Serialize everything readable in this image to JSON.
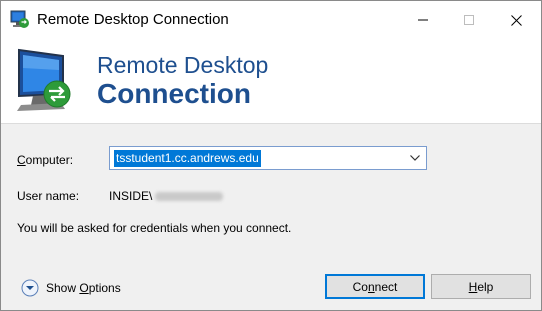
{
  "window": {
    "title": "Remote Desktop Connection"
  },
  "banner": {
    "line1": "Remote Desktop",
    "line2": "Connection"
  },
  "form": {
    "computer_label_underlined": "C",
    "computer_label_rest": "omputer:",
    "computer_value": "tsstudent1.cc.andrews.edu",
    "user_label": "User name:",
    "user_domain": "INSIDE\\",
    "info": "You will be asked for credentials when you connect."
  },
  "footer": {
    "options_label_pre": "Show ",
    "options_label_underlined": "O",
    "options_label_post": "ptions",
    "connect_pre": "Co",
    "connect_underlined": "n",
    "connect_post": "nect",
    "help_underlined": "H",
    "help_post": "elp"
  },
  "colors": {
    "accent": "#1e4f8f",
    "selection": "#0078d7"
  }
}
